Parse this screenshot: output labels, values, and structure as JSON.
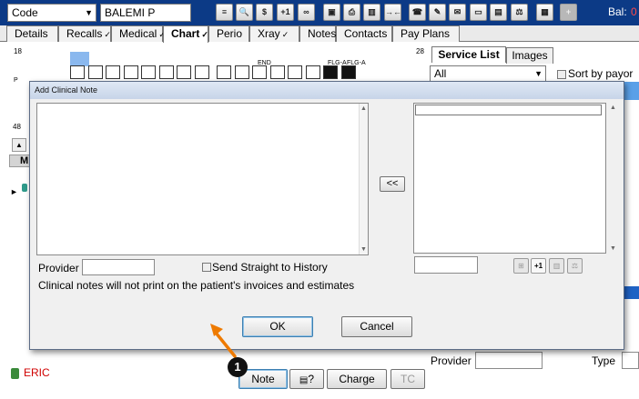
{
  "toolbar": {
    "mode_select": "Code",
    "patient_name": "BALEMI P",
    "buttons": [
      {
        "name": "list-icon",
        "glyph": "≡"
      },
      {
        "name": "search-icon",
        "glyph": "🔍"
      },
      {
        "name": "dollar-icon",
        "glyph": "$"
      },
      {
        "name": "plus-one-icon",
        "glyph": "+1"
      },
      {
        "name": "link-icon",
        "glyph": "∞"
      },
      {
        "name": "save-icon",
        "glyph": "▣"
      },
      {
        "name": "print-icon",
        "glyph": "⎙"
      },
      {
        "name": "trash-icon",
        "glyph": "▥"
      },
      {
        "name": "arrows-icon",
        "glyph": "→←"
      },
      {
        "name": "phone-icon",
        "glyph": "☎"
      },
      {
        "name": "edit-icon",
        "glyph": "✎"
      },
      {
        "name": "mail-icon",
        "glyph": "✉"
      },
      {
        "name": "card-icon",
        "glyph": "▭"
      },
      {
        "name": "note-icon",
        "glyph": "▤"
      },
      {
        "name": "scale-icon",
        "glyph": "⚖"
      },
      {
        "name": "calendar-icon",
        "glyph": "▦"
      },
      {
        "name": "add-icon",
        "glyph": "+"
      }
    ],
    "balance_label": "Bal:",
    "balance_value": "0"
  },
  "tabs": [
    {
      "label": "Details",
      "chk": ""
    },
    {
      "label": "Recalls",
      "chk": "✓"
    },
    {
      "label": "Medical",
      "chk": "✓"
    },
    {
      "label": "Chart",
      "chk": "✓"
    },
    {
      "label": "Perio",
      "chk": ""
    },
    {
      "label": "Xray",
      "chk": "✓"
    },
    {
      "label": "Notes",
      "chk": ""
    },
    {
      "label": "Contacts",
      "chk": ""
    },
    {
      "label": "Pay Plans",
      "chk": ""
    }
  ],
  "chart": {
    "tooth_18": "18",
    "tooth_28": "28",
    "tooth_48": "48",
    "end_label": "END",
    "flg_label_1": "FLG-A",
    "flg_label_2": "FLG-A",
    "row_m": "M"
  },
  "right_panel": {
    "tab_service": "Service List",
    "tab_images": "Images",
    "filter_select": "All",
    "sort_label": "Sort by payor co",
    "provider_label": "Provider",
    "type_label": "Type"
  },
  "bottom": {
    "user": "ERIC",
    "note_button": "Note",
    "query_button": "?",
    "charge_button": "Charge",
    "tc_button": "TC"
  },
  "dialog": {
    "title": "Add Clinical Note",
    "note_text": "",
    "transfer_button": "<<",
    "provider_label": "Provider",
    "provider_value": "",
    "send_history_label": "Send Straight to History",
    "info_text": "Clinical notes will not print on the patient's invoices and estimates",
    "ok_button": "OK",
    "cancel_button": "Cancel",
    "side_buttons": [
      "⊞",
      "+1",
      "▥",
      "⚖"
    ]
  },
  "annotation": {
    "step": "1"
  },
  "colors": {
    "topbar": "#0c3a86",
    "dialog_title": "#c7d4e8",
    "arrow": "#ee7a00",
    "user_red": "#d00000"
  }
}
